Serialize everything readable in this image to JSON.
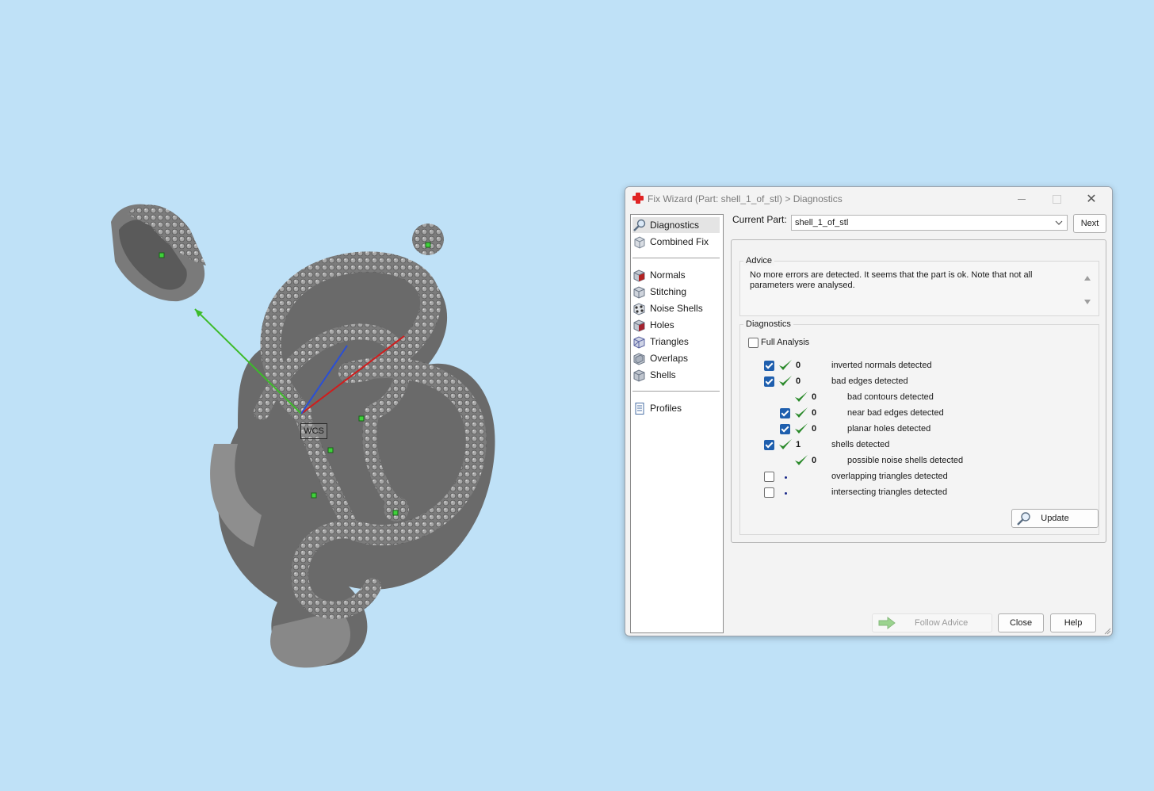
{
  "viewport": {
    "wcs_label": "WCS"
  },
  "window": {
    "title": "Fix Wizard (Part: shell_1_of_stl) > Diagnostics",
    "accent": "#1f5fae"
  },
  "nav": {
    "items": [
      {
        "label": "Diagnostics",
        "icon": "magnifier-icon"
      },
      {
        "label": "Combined Fix",
        "icon": "cube-icon"
      },
      {
        "label": "Normals",
        "icon": "normals-cube-icon"
      },
      {
        "label": "Stitching",
        "icon": "stitching-cube-icon"
      },
      {
        "label": "Noise Shells",
        "icon": "noise-shells-icon"
      },
      {
        "label": "Holes",
        "icon": "holes-cube-icon"
      },
      {
        "label": "Triangles",
        "icon": "triangles-cube-icon"
      },
      {
        "label": "Overlaps",
        "icon": "overlaps-cube-icon"
      },
      {
        "label": "Shells",
        "icon": "shells-cube-icon"
      },
      {
        "label": "Profiles",
        "icon": "document-icon"
      }
    ],
    "selected": "Diagnostics"
  },
  "current_part": {
    "label": "Current Part:",
    "value": "shell_1_of_stl",
    "next_label": "Next"
  },
  "advice": {
    "title": "Advice",
    "text": "No more errors are detected. It seems that the part is ok. Note that not all parameters were analysed."
  },
  "diagnostics": {
    "title": "Diagnostics",
    "full_analysis_label": "Full Analysis",
    "full_analysis_checked": false,
    "rows": [
      {
        "count": "0",
        "label": "inverted normals detected",
        "checked": true
      },
      {
        "count": "0",
        "label": "bad edges detected",
        "checked": true
      },
      {
        "count": "0",
        "label": "bad contours detected"
      },
      {
        "count": "0",
        "label": "near bad edges detected",
        "checked": true
      },
      {
        "count": "0",
        "label": "planar holes detected",
        "checked": true
      },
      {
        "count": "1",
        "label": "shells detected",
        "checked": true
      },
      {
        "count": "0",
        "label": "possible noise shells detected"
      },
      {
        "label": "overlapping triangles detected",
        "checked": false
      },
      {
        "label": "intersecting triangles detected",
        "checked": false
      }
    ],
    "update_label": "Update"
  },
  "footer": {
    "follow_advice_label": "Follow Advice",
    "close_label": "Close",
    "help_label": "Help"
  }
}
